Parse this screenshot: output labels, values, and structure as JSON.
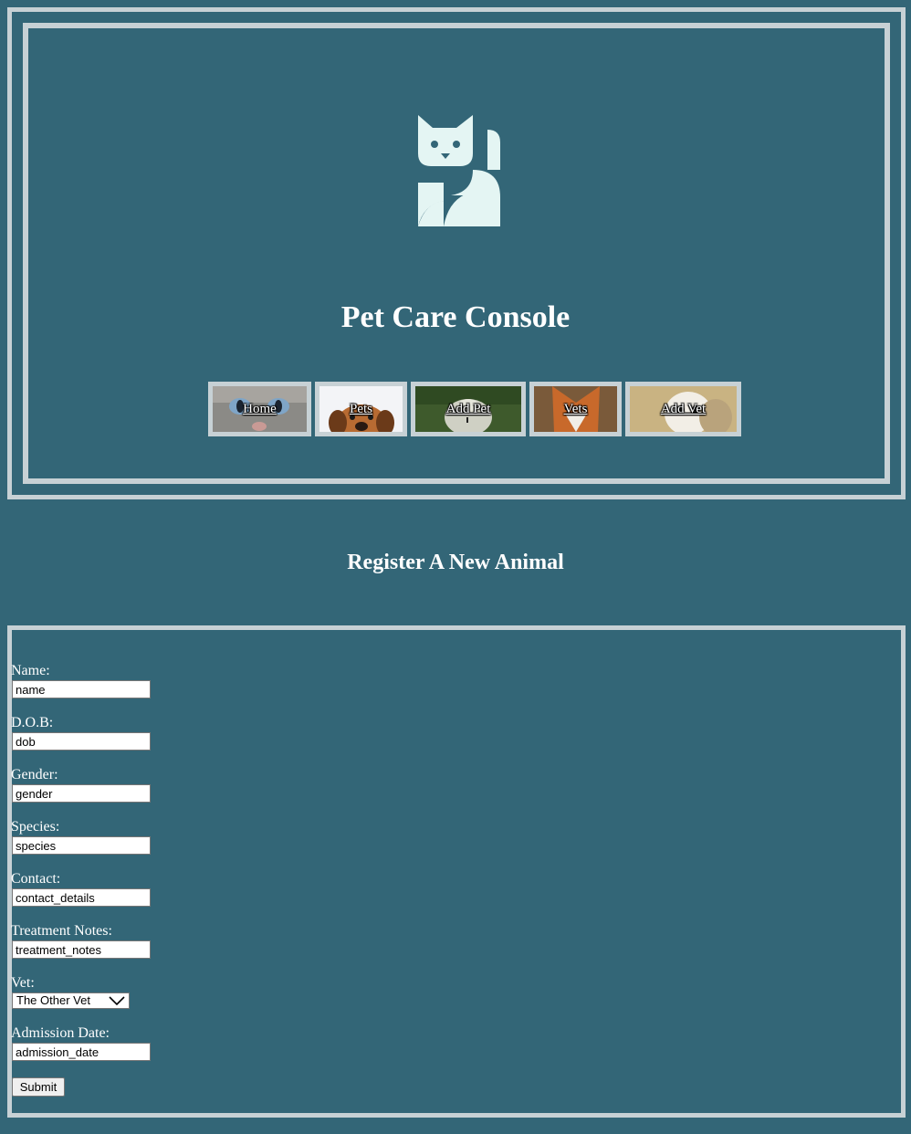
{
  "header": {
    "title": "Pet Care Console",
    "logo_icon": "cat-logo-icon"
  },
  "nav": {
    "items": [
      {
        "label": "Home",
        "image": "cat-photo"
      },
      {
        "label": "Pets",
        "image": "dog-photo"
      },
      {
        "label": "Add Pet",
        "image": "kitten-photo"
      },
      {
        "label": "Vets",
        "image": "fox-photo"
      },
      {
        "label": "Add Vet",
        "image": "owl-photo"
      }
    ]
  },
  "main": {
    "heading": "Register A New Animal"
  },
  "form": {
    "name_label": "Name:",
    "name_value": "name",
    "dob_label": "D.O.B:",
    "dob_value": "dob",
    "gender_label": "Gender:",
    "gender_value": "gender",
    "species_label": "Species:",
    "species_value": "species",
    "contact_label": "Contact:",
    "contact_value": "contact_details",
    "notes_label": "Treatment Notes:",
    "notes_value": "treatment_notes",
    "vet_label": "Vet:",
    "vet_selected": "The Other Vet",
    "admission_label": "Admission Date:",
    "admission_value": "admission_date",
    "submit_label": "Submit"
  },
  "colors": {
    "background": "#336677",
    "frame": "#c7d1d5",
    "logo": "#e4f5f3",
    "text": "#ffffff"
  }
}
